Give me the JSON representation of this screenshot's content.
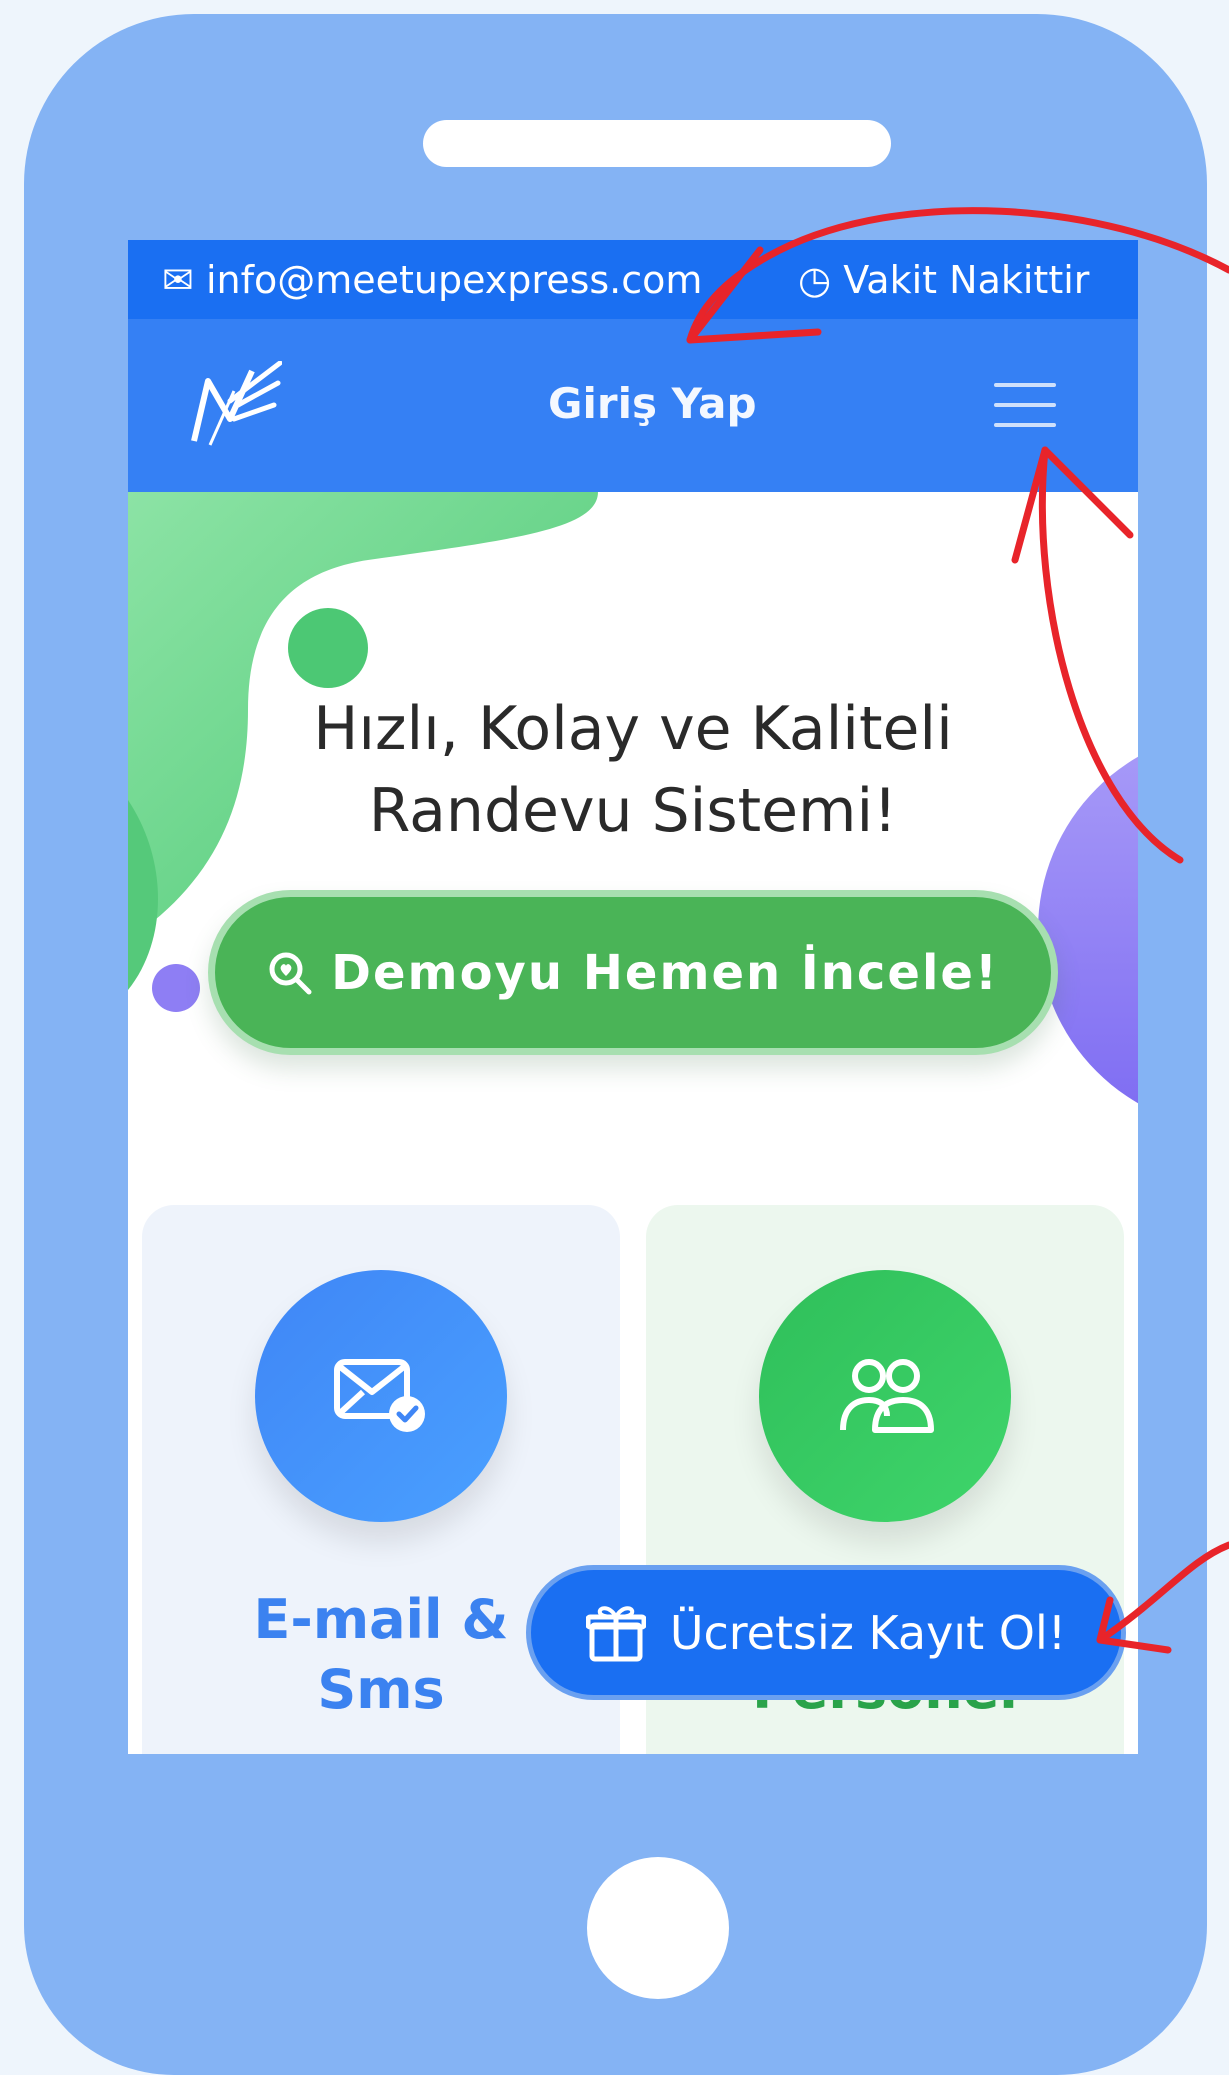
{
  "topbar": {
    "email": "info@meetupexpress.com",
    "tagline": "Vakit Nakittir"
  },
  "navbar": {
    "logo_text": "ME",
    "login_label": "Giriş Yap",
    "menu_icon": "hamburger-icon"
  },
  "hero": {
    "title_line1": "Hızlı, Kolay ve Kaliteli",
    "title_line2": "Randevu Sistemi!",
    "demo_button_label": "Demoyu Hemen İncele!",
    "demo_icon": "search-icon"
  },
  "features": [
    {
      "title_line1": "E-mail &",
      "title_line2": "Sms",
      "icon": "email-check-icon",
      "color": "#3b82f0"
    },
    {
      "title_line1": "Personel",
      "icon": "users-icon",
      "color": "#2aa34a"
    }
  ],
  "floating_cta": {
    "label": "Ücretsiz Kayıt Ol!",
    "icon": "gift-icon"
  },
  "colors": {
    "phone_frame": "#84b3f4",
    "nav_blue": "#3580f4",
    "topbar_blue": "#1a6ff2",
    "green": "#4ab457",
    "annotation_red": "#e8242a"
  }
}
